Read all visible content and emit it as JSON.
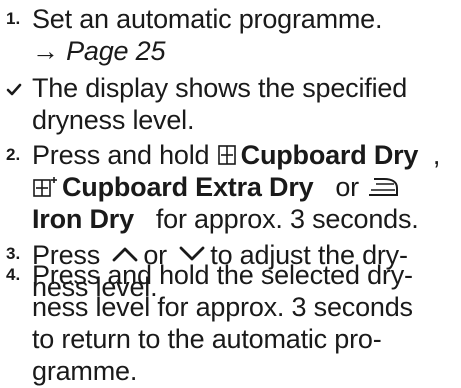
{
  "steps": [
    {
      "number": "1.",
      "lines": [
        "Set an automatic programme.",
        "→ Page 25"
      ],
      "page_prefix": "→ ",
      "page_ref": "Page 25"
    },
    {
      "marker_icon": "check-icon",
      "lines": [
        "The display shows the specified",
        "dryness level."
      ]
    },
    {
      "number": "2.",
      "prefix": "Press and hold",
      "option1": "Cupboard Dry",
      "comma": ",",
      "option2": "Cupboard Extra Dry",
      "or_text": "or",
      "option3": "Iron Dry",
      "suffix": "for approx. 3 seconds.",
      "icons": [
        "cupboard-dry-icon",
        "cupboard-extra-dry-icon",
        "iron-dry-icon"
      ]
    },
    {
      "number": "3.",
      "prefix": "Press",
      "or_text": "or",
      "suffix": "to adjust the dry-",
      "line2": "ness level.",
      "icons": [
        "chevron-up-icon",
        "chevron-down-icon"
      ]
    },
    {
      "number": "4.",
      "lines": [
        "Press and hold the selected dry-",
        "ness level for approx. 3 seconds",
        "to return to the automatic pro-",
        "gramme."
      ]
    }
  ]
}
